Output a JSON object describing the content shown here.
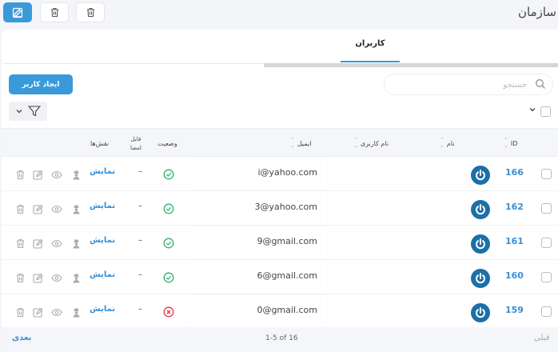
{
  "header": {
    "title": "سازمان"
  },
  "tabs": [
    {
      "label": "کاربران",
      "active": true
    }
  ],
  "toolbar": {
    "create_label": "ایجاد کاربر",
    "search_placeholder": "جستجو"
  },
  "table": {
    "columns": {
      "id": "ID",
      "name": "نام",
      "username": "نام کاربری",
      "email": "ایمیل",
      "status": "وضعیت",
      "file_line1": "فایل",
      "file_line2": "امضا",
      "roles": "نقش‌ها"
    },
    "rows": [
      {
        "id": "166",
        "email": "i@yahoo.com",
        "status": "active",
        "file": "–",
        "roles": "نمایش"
      },
      {
        "id": "162",
        "email": "3@yahoo.com",
        "status": "active",
        "file": "–",
        "roles": "نمایش"
      },
      {
        "id": "161",
        "email": "9@gmail.com",
        "status": "active",
        "file": "–",
        "roles": "نمایش"
      },
      {
        "id": "160",
        "email": "6@gmail.com",
        "status": "active",
        "file": "–",
        "roles": "نمایش"
      },
      {
        "id": "159",
        "email": "0@gmail.com",
        "status": "inactive",
        "file": "–",
        "roles": "نمایش"
      }
    ]
  },
  "pagination": {
    "prev": "قبلی",
    "next": "بعدی",
    "info": "1-5 of 16"
  },
  "colors": {
    "accent": "#3a9ad9",
    "success": "#2db36f",
    "danger": "#e0344a"
  }
}
